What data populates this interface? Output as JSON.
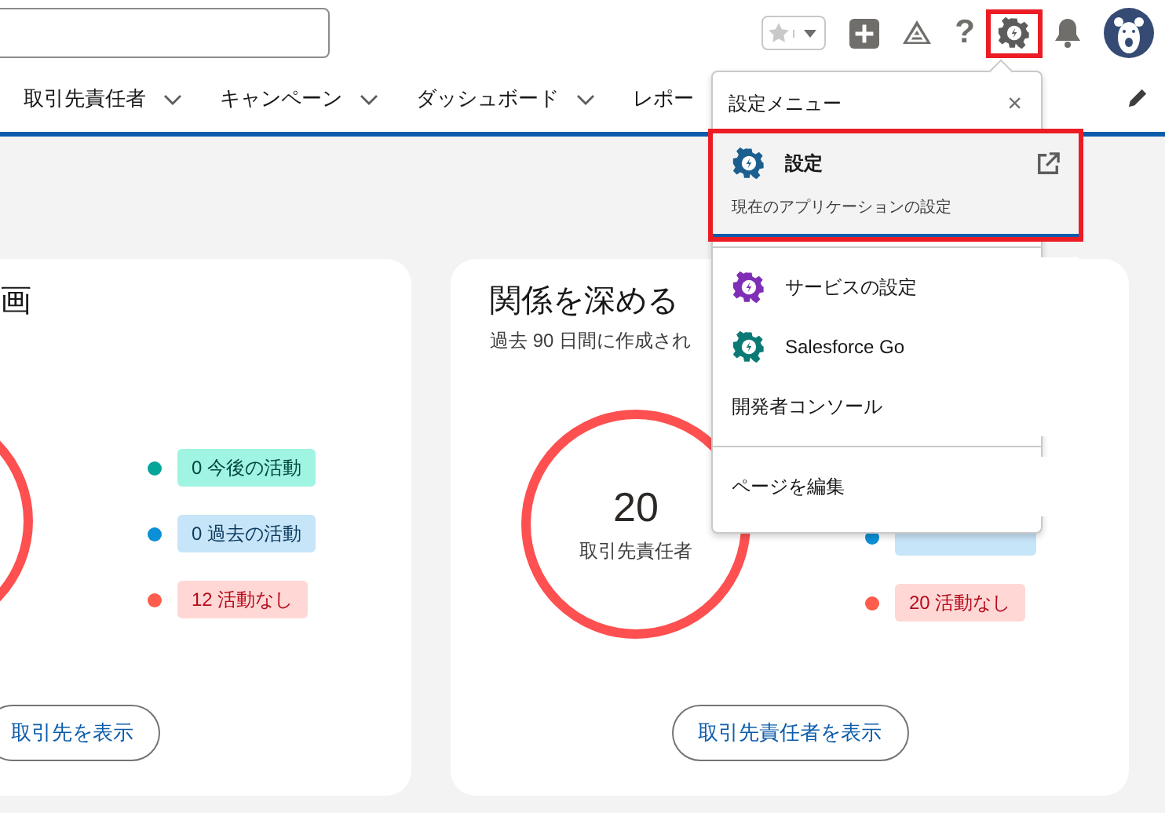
{
  "header": {
    "toolbar": [
      {
        "kind": "favorites",
        "highlighted": false
      },
      {
        "kind": "add",
        "highlighted": false
      },
      {
        "kind": "trail",
        "highlighted": false
      },
      {
        "kind": "help",
        "label": "?",
        "highlighted": false
      },
      {
        "kind": "setup",
        "highlighted": true
      },
      {
        "kind": "notifications",
        "highlighted": false
      },
      {
        "kind": "avatar",
        "highlighted": false
      }
    ]
  },
  "nav": {
    "items": [
      {
        "label": "取引先責任者",
        "dropdown": true
      },
      {
        "label": "キャンペーン",
        "dropdown": true
      },
      {
        "label": "ダッシュボード",
        "dropdown": true
      },
      {
        "label": "レポー",
        "dropdown": false
      }
    ]
  },
  "cards": [
    {
      "title": "画",
      "button": "取引先を表示",
      "legend": [
        {
          "kind": "upcoming",
          "label": "0 今後の活動",
          "color": "#06a59a"
        },
        {
          "kind": "past",
          "label": "0 過去の活動",
          "color": "#0b8fd6"
        },
        {
          "kind": "none",
          "label": "12 活動なし",
          "color": "#fe5c4c"
        }
      ]
    },
    {
      "title": "関係を深める",
      "subtitle": "過去 90 日間に作成され",
      "total": "20",
      "total_label": "取引先責任者",
      "button": "取引先責任者を表示",
      "legend": [
        {
          "kind": "past",
          "color": "#0b8fd6"
        },
        {
          "kind": "none",
          "label": "20 活動なし",
          "color": "#fe5c4c"
        }
      ]
    }
  ],
  "setup_menu": {
    "title": "設定メニュー",
    "close": "×",
    "sections": [
      [
        {
          "label": "設定",
          "description": "現在のアプリケーションの設定",
          "color": "#1b5f8f",
          "external": true,
          "selected": true,
          "highlighted": true
        }
      ],
      [
        {
          "label": "サービスの設定",
          "color": "#7f2fb5",
          "external": false,
          "selected": false,
          "highlighted": false
        },
        {
          "label": "Salesforce Go",
          "color": "#0b7a75",
          "external": false,
          "selected": false,
          "highlighted": false
        },
        {
          "label": "開発者コンソール",
          "external": false,
          "selected": false,
          "highlighted": false
        }
      ],
      [
        {
          "label": "ページを編集",
          "external": false,
          "selected": false,
          "highlighted": false
        }
      ]
    ]
  }
}
